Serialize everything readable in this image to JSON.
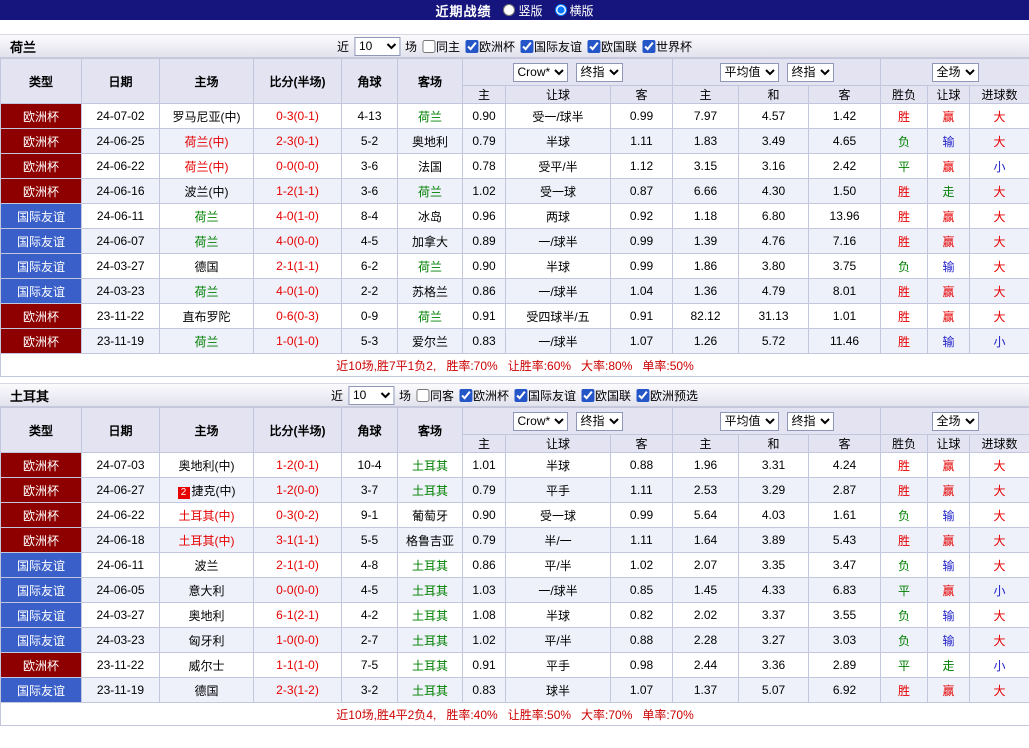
{
  "topbar": {
    "title": "近期战绩",
    "views": [
      {
        "label": "竖版",
        "selected": false
      },
      {
        "label": "横版",
        "selected": true
      }
    ]
  },
  "columns": {
    "static": [
      "类型",
      "日期",
      "主场",
      "比分(半场)",
      "角球",
      "客场"
    ],
    "group1_cols": [
      "主",
      "让球",
      "客"
    ],
    "group2_cols": [
      "主",
      "和",
      "客"
    ],
    "group3_cols": [
      "胜负",
      "让球",
      "进球数"
    ],
    "selects": {
      "provider": "Crow*",
      "stage1": "终指",
      "average": "平均值",
      "stage2": "终指",
      "scope": "全场"
    }
  },
  "colors": {
    "euro": "#8e0000",
    "friendly": "#3a5fc8",
    "r": "#e60000",
    "g": "#008000",
    "b": "#1f1fc8",
    "k": "#000000"
  },
  "sections": [
    {
      "team": "荷兰",
      "filter": {
        "near_label": "近",
        "count": "10",
        "matches_label": "场",
        "venue": {
          "label": "同主",
          "checked": false
        },
        "competitions": [
          {
            "label": "欧洲杯",
            "checked": true
          },
          {
            "label": "国际友谊",
            "checked": true
          },
          {
            "label": "欧国联",
            "checked": true
          },
          {
            "label": "世界杯",
            "checked": true
          }
        ]
      },
      "rows": [
        {
          "type": "欧洲杯",
          "tk": "euro",
          "date": "24-07-02",
          "home": "罗马尼亚(中)",
          "hc": "k",
          "score": "0-3(0-1)",
          "corner": "4-13",
          "away": "荷兰",
          "ac": "g",
          "o": [
            "0.90",
            "受一/球半",
            "0.99"
          ],
          "a": [
            "7.97",
            "4.57",
            "1.42"
          ],
          "r": [
            "胜",
            "赢",
            "大"
          ],
          "rc": [
            "r",
            "r",
            "r"
          ]
        },
        {
          "type": "欧洲杯",
          "tk": "euro",
          "date": "24-06-25",
          "home": "荷兰(中)",
          "hc": "r",
          "score": "2-3(0-1)",
          "corner": "5-2",
          "away": "奥地利",
          "ac": "k",
          "o": [
            "0.79",
            "半球",
            "1.11"
          ],
          "a": [
            "1.83",
            "3.49",
            "4.65"
          ],
          "r": [
            "负",
            "输",
            "大"
          ],
          "rc": [
            "g",
            "b",
            "r"
          ]
        },
        {
          "type": "欧洲杯",
          "tk": "euro",
          "date": "24-06-22",
          "home": "荷兰(中)",
          "hc": "r",
          "score": "0-0(0-0)",
          "corner": "3-6",
          "away": "法国",
          "ac": "k",
          "o": [
            "0.78",
            "受平/半",
            "1.12"
          ],
          "a": [
            "3.15",
            "3.16",
            "2.42"
          ],
          "r": [
            "平",
            "赢",
            "小"
          ],
          "rc": [
            "g",
            "r",
            "b"
          ]
        },
        {
          "type": "欧洲杯",
          "tk": "euro",
          "date": "24-06-16",
          "home": "波兰(中)",
          "hc": "k",
          "score": "1-2(1-1)",
          "corner": "3-6",
          "away": "荷兰",
          "ac": "g",
          "o": [
            "1.02",
            "受一球",
            "0.87"
          ],
          "a": [
            "6.66",
            "4.30",
            "1.50"
          ],
          "r": [
            "胜",
            "走",
            "大"
          ],
          "rc": [
            "r",
            "g",
            "r"
          ]
        },
        {
          "type": "国际友谊",
          "tk": "friendly",
          "date": "24-06-11",
          "home": "荷兰",
          "hc": "g",
          "score": "4-0(1-0)",
          "corner": "8-4",
          "away": "冰岛",
          "ac": "k",
          "o": [
            "0.96",
            "两球",
            "0.92"
          ],
          "a": [
            "1.18",
            "6.80",
            "13.96"
          ],
          "r": [
            "胜",
            "赢",
            "大"
          ],
          "rc": [
            "r",
            "r",
            "r"
          ]
        },
        {
          "type": "国际友谊",
          "tk": "friendly",
          "date": "24-06-07",
          "home": "荷兰",
          "hc": "g",
          "score": "4-0(0-0)",
          "corner": "4-5",
          "away": "加拿大",
          "ac": "k",
          "o": [
            "0.89",
            "一/球半",
            "0.99"
          ],
          "a": [
            "1.39",
            "4.76",
            "7.16"
          ],
          "r": [
            "胜",
            "赢",
            "大"
          ],
          "rc": [
            "r",
            "r",
            "r"
          ]
        },
        {
          "type": "国际友谊",
          "tk": "friendly",
          "date": "24-03-27",
          "home": "德国",
          "hc": "k",
          "score": "2-1(1-1)",
          "corner": "6-2",
          "away": "荷兰",
          "ac": "g",
          "o": [
            "0.90",
            "半球",
            "0.99"
          ],
          "a": [
            "1.86",
            "3.80",
            "3.75"
          ],
          "r": [
            "负",
            "输",
            "大"
          ],
          "rc": [
            "g",
            "b",
            "r"
          ]
        },
        {
          "type": "国际友谊",
          "tk": "friendly",
          "date": "24-03-23",
          "home": "荷兰",
          "hc": "g",
          "score": "4-0(1-0)",
          "corner": "2-2",
          "away": "苏格兰",
          "ac": "k",
          "o": [
            "0.86",
            "一/球半",
            "1.04"
          ],
          "a": [
            "1.36",
            "4.79",
            "8.01"
          ],
          "r": [
            "胜",
            "赢",
            "大"
          ],
          "rc": [
            "r",
            "r",
            "r"
          ]
        },
        {
          "type": "欧洲杯",
          "tk": "euro",
          "date": "23-11-22",
          "home": "直布罗陀",
          "hc": "k",
          "score": "0-6(0-3)",
          "corner": "0-9",
          "away": "荷兰",
          "ac": "g",
          "o": [
            "0.91",
            "受四球半/五",
            "0.91"
          ],
          "a": [
            "82.12",
            "31.13",
            "1.01"
          ],
          "r": [
            "胜",
            "赢",
            "大"
          ],
          "rc": [
            "r",
            "r",
            "r"
          ]
        },
        {
          "type": "欧洲杯",
          "tk": "euro",
          "date": "23-11-19",
          "home": "荷兰",
          "hc": "g",
          "score": "1-0(1-0)",
          "corner": "5-3",
          "away": "爱尔兰",
          "ac": "k",
          "o": [
            "0.83",
            "一/球半",
            "1.07"
          ],
          "a": [
            "1.26",
            "5.72",
            "11.46"
          ],
          "r": [
            "胜",
            "输",
            "小"
          ],
          "rc": [
            "r",
            "b",
            "b"
          ]
        }
      ],
      "summary": {
        "prefix": "近10场,胜7平1负2,",
        "stats": [
          "胜率:70%",
          "让胜率:60%",
          "大率:80%",
          "单率:50%"
        ]
      }
    },
    {
      "team": "土耳其",
      "filter": {
        "near_label": "近",
        "count": "10",
        "matches_label": "场",
        "venue": {
          "label": "同客",
          "checked": false
        },
        "competitions": [
          {
            "label": "欧洲杯",
            "checked": true
          },
          {
            "label": "国际友谊",
            "checked": true
          },
          {
            "label": "欧国联",
            "checked": true
          },
          {
            "label": "欧洲预选",
            "checked": true
          }
        ]
      },
      "rows": [
        {
          "type": "欧洲杯",
          "tk": "euro",
          "date": "24-07-03",
          "home": "奥地利(中)",
          "hc": "k",
          "score": "1-2(0-1)",
          "corner": "10-4",
          "away": "土耳其",
          "ac": "g",
          "o": [
            "1.01",
            "半球",
            "0.88"
          ],
          "a": [
            "1.96",
            "3.31",
            "4.24"
          ],
          "r": [
            "胜",
            "赢",
            "大"
          ],
          "rc": [
            "r",
            "r",
            "r"
          ]
        },
        {
          "type": "欧洲杯",
          "tk": "euro",
          "date": "24-06-27",
          "home": "捷克(中)",
          "hc": "k",
          "badge": "2",
          "score": "1-2(0-0)",
          "corner": "3-7",
          "away": "土耳其",
          "ac": "g",
          "o": [
            "0.79",
            "平手",
            "1.11"
          ],
          "a": [
            "2.53",
            "3.29",
            "2.87"
          ],
          "r": [
            "胜",
            "赢",
            "大"
          ],
          "rc": [
            "r",
            "r",
            "r"
          ]
        },
        {
          "type": "欧洲杯",
          "tk": "euro",
          "date": "24-06-22",
          "home": "土耳其(中)",
          "hc": "r",
          "score": "0-3(0-2)",
          "corner": "9-1",
          "away": "葡萄牙",
          "ac": "k",
          "o": [
            "0.90",
            "受一球",
            "0.99"
          ],
          "a": [
            "5.64",
            "4.03",
            "1.61"
          ],
          "r": [
            "负",
            "输",
            "大"
          ],
          "rc": [
            "g",
            "b",
            "r"
          ]
        },
        {
          "type": "欧洲杯",
          "tk": "euro",
          "date": "24-06-18",
          "home": "土耳其(中)",
          "hc": "r",
          "score": "3-1(1-1)",
          "corner": "5-5",
          "away": "格鲁吉亚",
          "ac": "k",
          "o": [
            "0.79",
            "半/一",
            "1.11"
          ],
          "a": [
            "1.64",
            "3.89",
            "5.43"
          ],
          "r": [
            "胜",
            "赢",
            "大"
          ],
          "rc": [
            "r",
            "r",
            "r"
          ]
        },
        {
          "type": "国际友谊",
          "tk": "friendly",
          "date": "24-06-11",
          "home": "波兰",
          "hc": "k",
          "score": "2-1(1-0)",
          "corner": "4-8",
          "away": "土耳其",
          "ac": "g",
          "o": [
            "0.86",
            "平/半",
            "1.02"
          ],
          "a": [
            "2.07",
            "3.35",
            "3.47"
          ],
          "r": [
            "负",
            "输",
            "大"
          ],
          "rc": [
            "g",
            "b",
            "r"
          ]
        },
        {
          "type": "国际友谊",
          "tk": "friendly",
          "date": "24-06-05",
          "home": "意大利",
          "hc": "k",
          "score": "0-0(0-0)",
          "corner": "4-5",
          "away": "土耳其",
          "ac": "g",
          "o": [
            "1.03",
            "一/球半",
            "0.85"
          ],
          "a": [
            "1.45",
            "4.33",
            "6.83"
          ],
          "r": [
            "平",
            "赢",
            "小"
          ],
          "rc": [
            "g",
            "r",
            "b"
          ]
        },
        {
          "type": "国际友谊",
          "tk": "friendly",
          "date": "24-03-27",
          "home": "奥地利",
          "hc": "k",
          "score": "6-1(2-1)",
          "corner": "4-2",
          "away": "土耳其",
          "ac": "g",
          "o": [
            "1.08",
            "半球",
            "0.82"
          ],
          "a": [
            "2.02",
            "3.37",
            "3.55"
          ],
          "r": [
            "负",
            "输",
            "大"
          ],
          "rc": [
            "g",
            "b",
            "r"
          ]
        },
        {
          "type": "国际友谊",
          "tk": "friendly",
          "date": "24-03-23",
          "home": "匈牙利",
          "hc": "k",
          "score": "1-0(0-0)",
          "corner": "2-7",
          "away": "土耳其",
          "ac": "g",
          "o": [
            "1.02",
            "平/半",
            "0.88"
          ],
          "a": [
            "2.28",
            "3.27",
            "3.03"
          ],
          "r": [
            "负",
            "输",
            "大"
          ],
          "rc": [
            "g",
            "b",
            "r"
          ]
        },
        {
          "type": "欧洲杯",
          "tk": "euro",
          "date": "23-11-22",
          "home": "威尔士",
          "hc": "k",
          "score": "1-1(1-0)",
          "corner": "7-5",
          "away": "土耳其",
          "ac": "g",
          "o": [
            "0.91",
            "平手",
            "0.98"
          ],
          "a": [
            "2.44",
            "3.36",
            "2.89"
          ],
          "r": [
            "平",
            "走",
            "小"
          ],
          "rc": [
            "g",
            "g",
            "b"
          ]
        },
        {
          "type": "国际友谊",
          "tk": "friendly",
          "date": "23-11-19",
          "home": "德国",
          "hc": "k",
          "score": "2-3(1-2)",
          "corner": "3-2",
          "away": "土耳其",
          "ac": "g",
          "o": [
            "0.83",
            "球半",
            "1.07"
          ],
          "a": [
            "1.37",
            "5.07",
            "6.92"
          ],
          "r": [
            "胜",
            "赢",
            "大"
          ],
          "rc": [
            "r",
            "r",
            "r"
          ]
        }
      ],
      "summary": {
        "prefix": "近10场,胜4平2负4,",
        "stats": [
          "胜率:40%",
          "让胜率:50%",
          "大率:70%",
          "单率:70%"
        ]
      }
    }
  ]
}
